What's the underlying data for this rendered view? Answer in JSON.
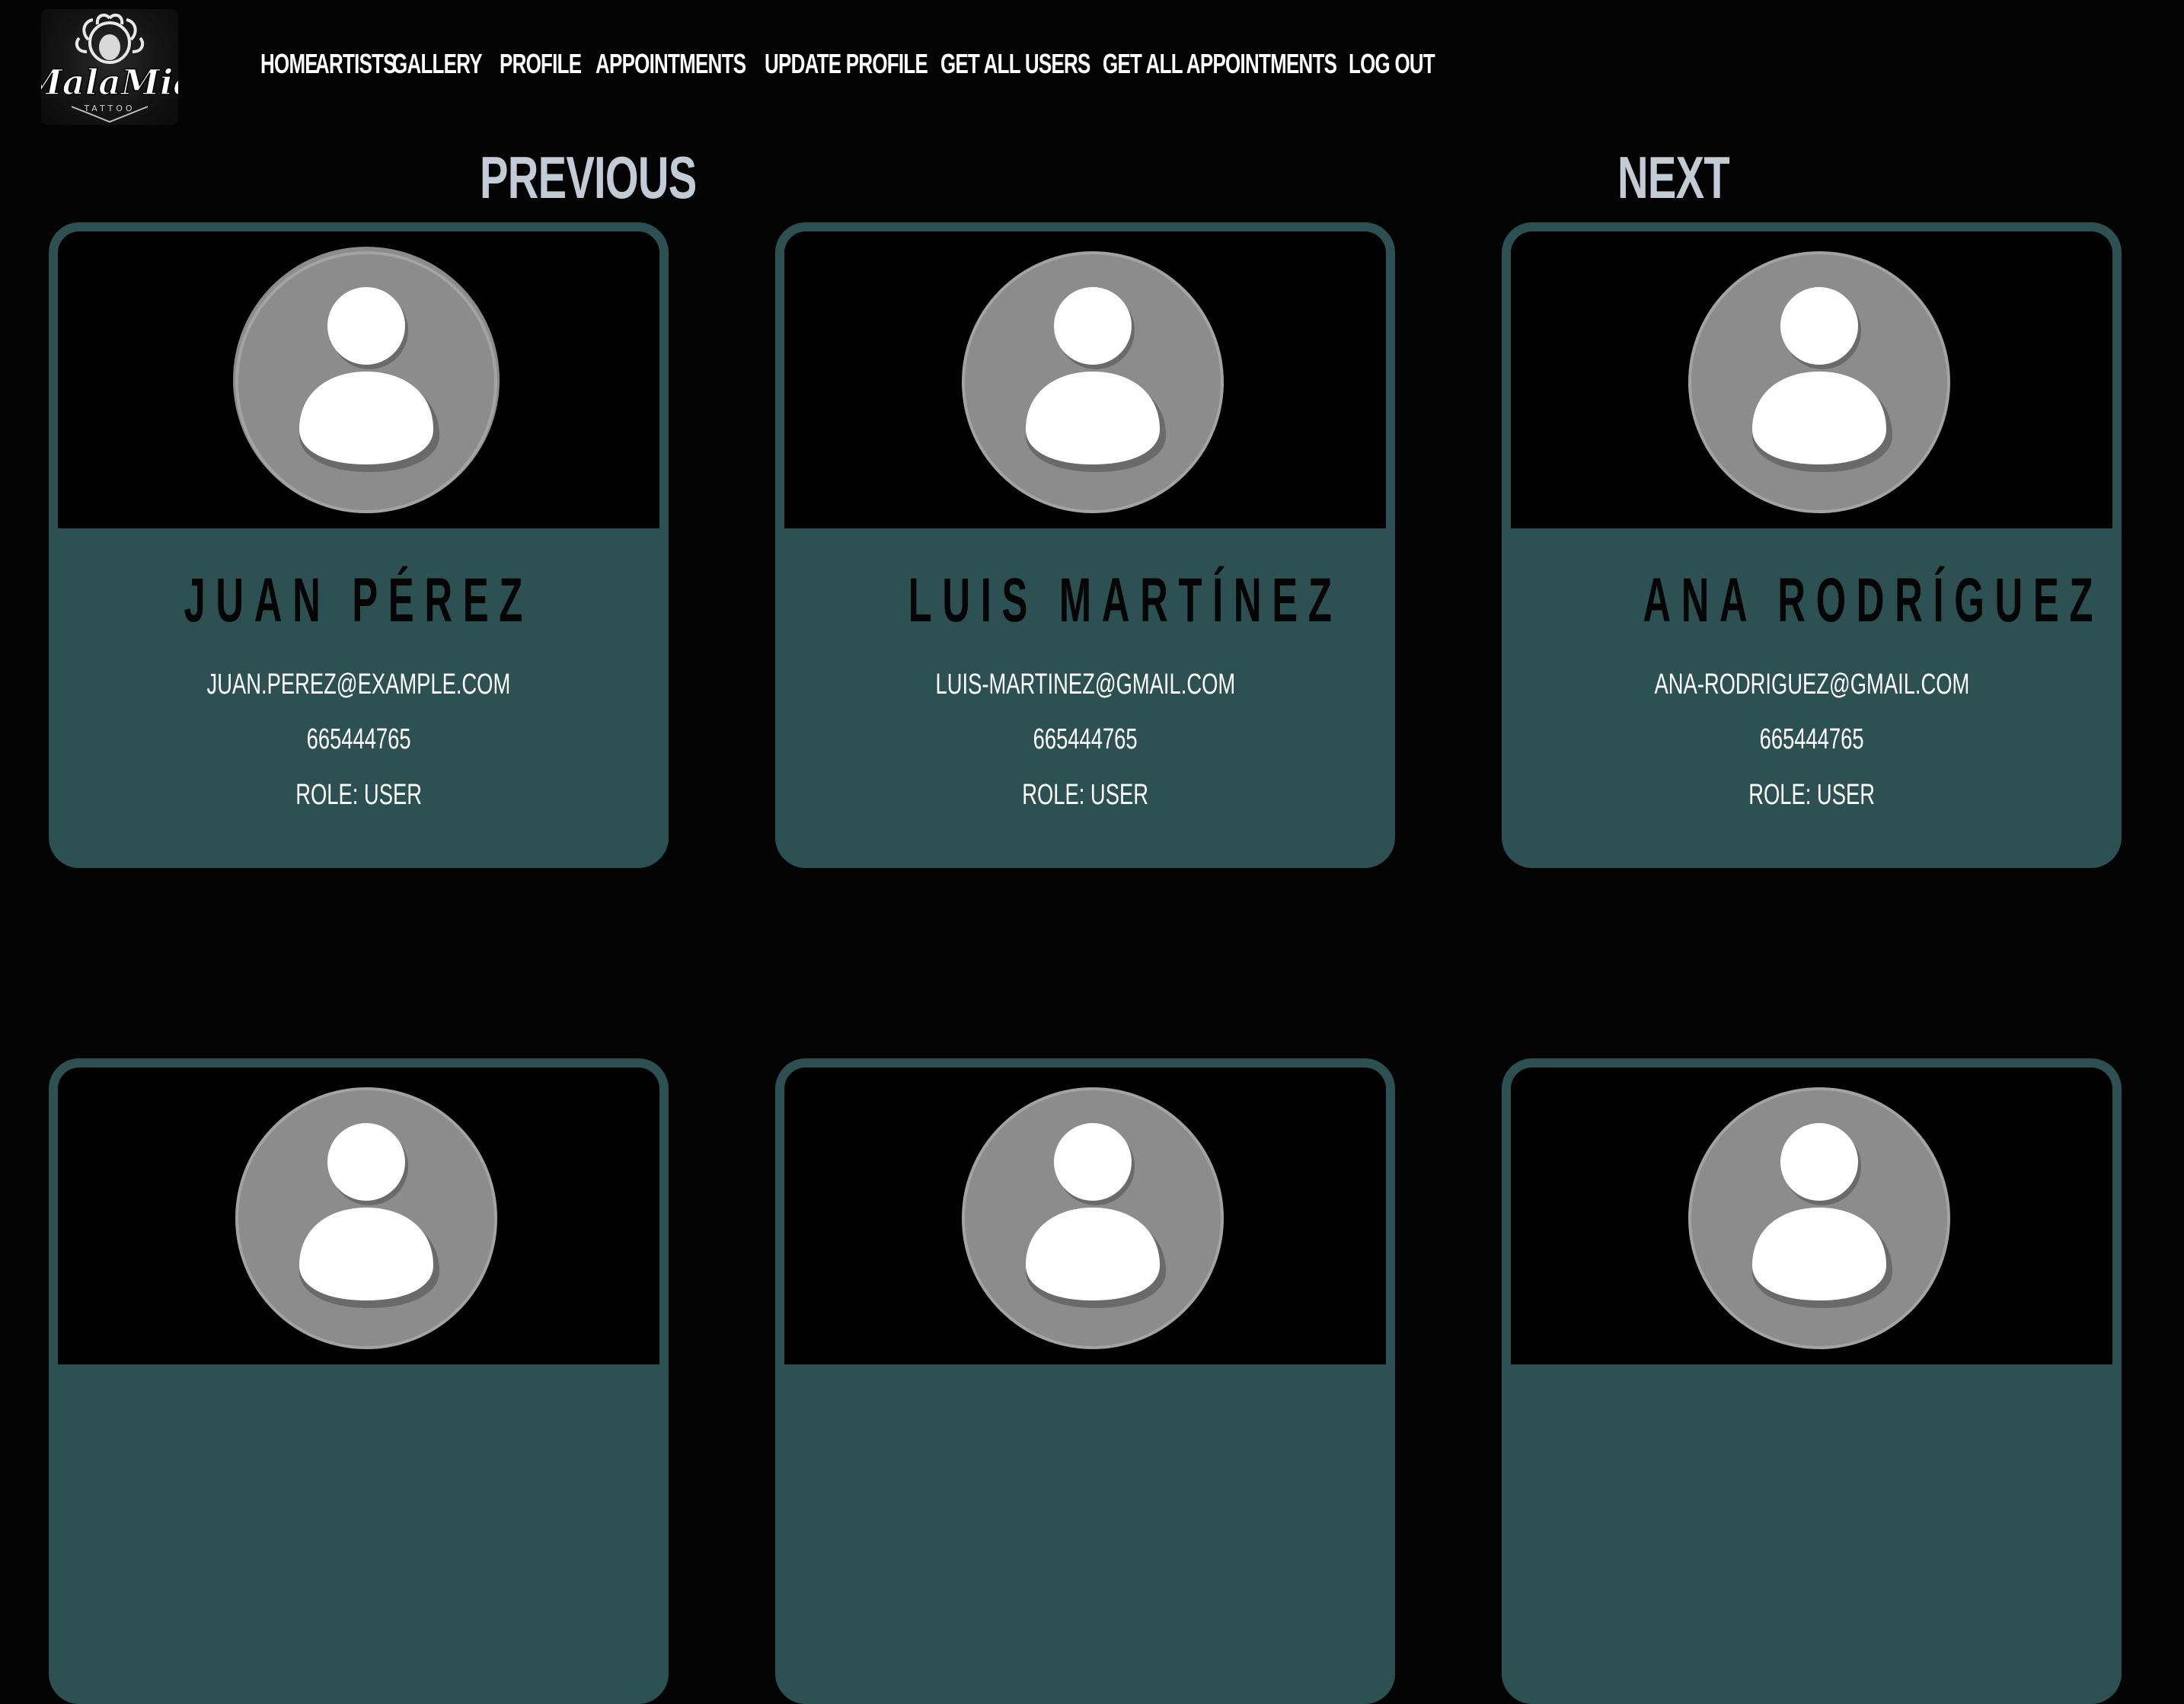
{
  "header": {
    "logo_text": "MalaMia Tattoo",
    "nav": [
      {
        "label": "HOME"
      },
      {
        "label": "ARTISTS"
      },
      {
        "label": "GALLERY"
      },
      {
        "label": "PROFILE"
      },
      {
        "label": "APPOINTMENTS"
      },
      {
        "label": "UPDATE PROFILE"
      },
      {
        "label": "GET ALL USERS"
      },
      {
        "label": "GET ALL APPOINTMENTS"
      },
      {
        "label": "LOG OUT"
      }
    ]
  },
  "pagination": {
    "previous_label": "PREVIOUS",
    "next_label": "NEXT"
  },
  "users": [
    {
      "name": "JUAN PÉREZ",
      "email": "JUAN.PEREZ@EXAMPLE.COM",
      "phone": "665444765",
      "role": "ROLE: USER"
    },
    {
      "name": "LUIS MARTÍNEZ",
      "email": "LUIS-MARTINEZ@GMAIL.COM",
      "phone": "665444765",
      "role": "ROLE: USER"
    },
    {
      "name": "ANA RODRÍGUEZ",
      "email": "ANA-RODRIGUEZ@GMAIL.COM",
      "phone": "665444765",
      "role": "ROLE: USER"
    }
  ],
  "colors": {
    "background": "#040404",
    "card": "#2d5152",
    "pager_text": "#c3cbd6",
    "avatar_bg": "#8c8c8c"
  }
}
